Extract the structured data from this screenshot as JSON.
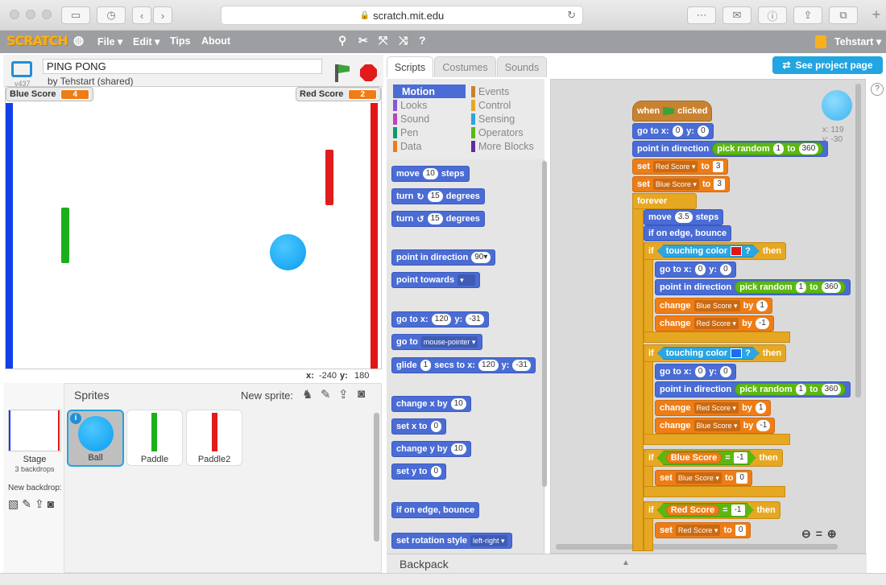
{
  "browser": {
    "url": "scratch.mit.edu"
  },
  "menubar": {
    "logo": "SCRATCH",
    "file": "File ▾",
    "edit": "Edit ▾",
    "tips": "Tips",
    "about": "About",
    "user": "Tehstart ▾"
  },
  "project": {
    "title": "PING PONG",
    "version": "v437",
    "byline": "by Tehstart (shared)",
    "see_page": "See project page"
  },
  "stage": {
    "monitor_blue_label": "Blue Score",
    "monitor_blue_value": "4",
    "monitor_red_label": "Red Score",
    "monitor_red_value": "2",
    "x_label": "x:",
    "x_value": "-240",
    "y_label": "y:",
    "y_value": "180"
  },
  "sprites": {
    "header": "Sprites",
    "new_sprite": "New sprite:",
    "stage_label": "Stage",
    "stage_sub": "3 backdrops",
    "new_backdrop": "New backdrop:",
    "items": [
      "Ball",
      "Paddle",
      "Paddle2"
    ]
  },
  "tabs": [
    "Scripts",
    "Costumes",
    "Sounds"
  ],
  "categories": {
    "left": [
      "Motion",
      "Looks",
      "Sound",
      "Pen",
      "Data"
    ],
    "right": [
      "Events",
      "Control",
      "Sensing",
      "Operators",
      "More Blocks"
    ]
  },
  "palette": {
    "move": "move",
    "steps": "steps",
    "v10": "10",
    "turn": "turn",
    "degrees": "degrees",
    "v15": "15",
    "point_dir": "point in direction",
    "v90": "90▾",
    "point_towards": "point towards",
    "goto_x": "go to x:",
    "v120": "120",
    "y": "y:",
    "vm31": "-31",
    "goto": "go to",
    "mouse": "mouse-pointer ▾",
    "glide": "glide",
    "v1": "1",
    "secs_to_x": "secs to x:",
    "change_x": "change x by",
    "set_x": "set x to",
    "v0": "0",
    "change_y": "change y by",
    "set_y": "set y to",
    "bounce": "if on edge, bounce",
    "rot_style": "set rotation style",
    "left_right": "left-right ▾"
  },
  "script": {
    "when": "when",
    "clicked": "clicked",
    "goto_x": "go to x:",
    "y": "y:",
    "zero": "0",
    "point_dir": "point in direction",
    "pick_random": "pick random",
    "to": "to",
    "one": "1",
    "v360": "360",
    "set": "set",
    "red_score": "Red Score ▾",
    "blue_score": "Blue Score ▾",
    "three": "3",
    "forever": "forever",
    "move": "move",
    "v35": "3.5",
    "steps": "steps",
    "bounce": "if on edge, bounce",
    "if": "if",
    "then": "then",
    "touching_color": "touching color",
    "q": "?",
    "change": "change",
    "by": "by",
    "m1": "-1",
    "blue_score_var": "Blue Score",
    "red_score_var": "Red Score",
    "eq": "=",
    "sprite_x": "x: 119",
    "sprite_y": "y: -30"
  },
  "backpack": "Backpack",
  "colors": {
    "motion": "#4a6cd4",
    "control": "#e6a822",
    "data": "#ee7d16",
    "operators": "#5cb712",
    "sensing": "#2ca5e2",
    "events": "#c88330"
  }
}
